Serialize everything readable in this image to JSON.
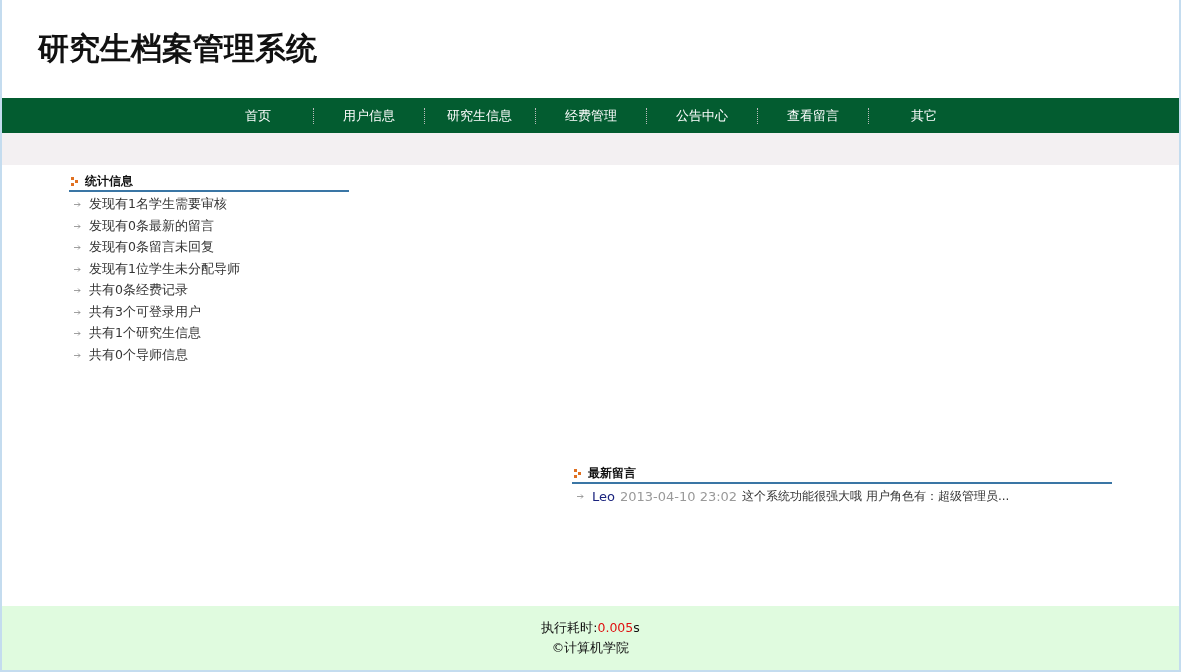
{
  "site_title": "研究生档案管理系统",
  "nav": [
    {
      "label": "首页"
    },
    {
      "label": "用户信息"
    },
    {
      "label": "研究生信息"
    },
    {
      "label": "经费管理"
    },
    {
      "label": "公告中心"
    },
    {
      "label": "查看留言"
    },
    {
      "label": "其它"
    }
  ],
  "stats": {
    "title": "统计信息",
    "items": [
      "发现有1名学生需要审核",
      "发现有0条最新的留言",
      "发现有0条留言未回复",
      "发现有1位学生未分配导师",
      "共有0条经费记录",
      "共有3个可登录用户",
      "共有1个研究生信息",
      "共有0个导师信息"
    ]
  },
  "messages": {
    "title": "最新留言",
    "items": [
      {
        "author": "Leo",
        "time": "2013-04-10 23:02",
        "text": "这个系统功能很强大哦 用户角色有：超级管理员..."
      }
    ]
  },
  "footer": {
    "runtime_label": "执行耗时:",
    "runtime_value": "0.005",
    "runtime_unit": "s",
    "copyright": "©计算机学院"
  }
}
